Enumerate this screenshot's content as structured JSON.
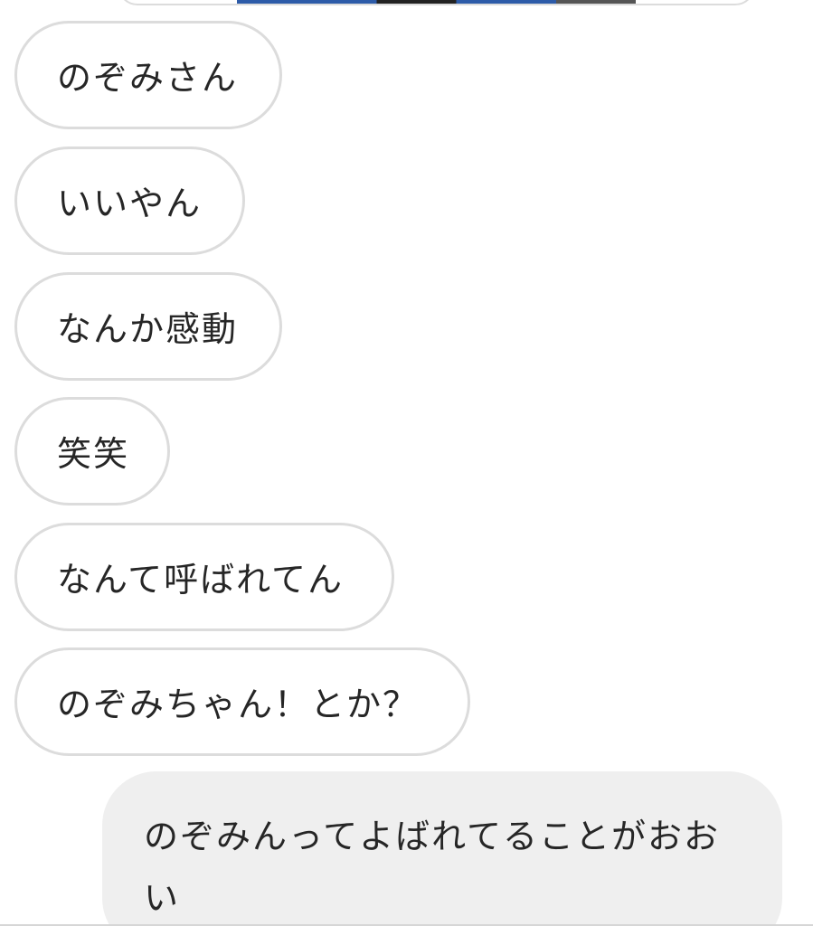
{
  "thread": {
    "received_messages": [
      {
        "text": "のぞみさん"
      },
      {
        "text": "いいやん"
      },
      {
        "text": "なんか感動"
      },
      {
        "text": "笑笑"
      },
      {
        "text": "なんて呼ばれてん"
      },
      {
        "text": "のぞみちゃん！とか？"
      }
    ],
    "sent_messages": [
      {
        "text": "のぞみんってよばれてることがおおい"
      }
    ]
  },
  "colors": {
    "incoming_bubble_border": "#dcdcdc",
    "outgoing_bubble_bg": "#efefef",
    "text": "#262626"
  }
}
